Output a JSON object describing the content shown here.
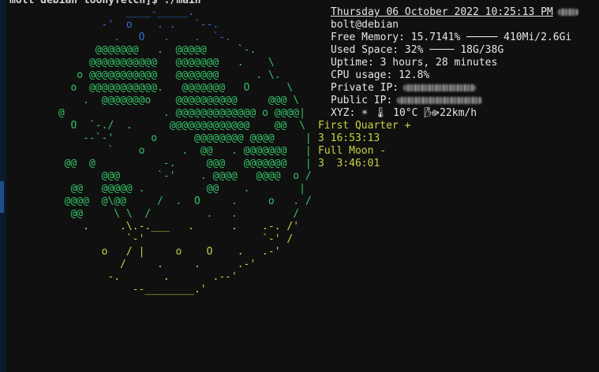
{
  "prompt": "mott debian toonyfetch]$ ./main",
  "art_lines": [
    {
      "color": "blue",
      "text": "            ____-_____."
    },
    {
      "color": "blue",
      "text": "        -'  o    . .   `--."
    },
    {
      "color": "blue",
      "text": "          .   O   .    .  `-."
    },
    {
      "color": "green",
      "text": "       @@@@@@@   .  @@@@@     `-."
    },
    {
      "color": "green",
      "text": "      @@@@@@@@@@@   @@@@@@@   .    \\"
    },
    {
      "color": "green",
      "text": "    o @@@@@@@@@@@   @@@@@@@      . \\."
    },
    {
      "color": "green",
      "text": "   o  @@@@@@@@@@@.   @@@@@@@   O      \\"
    },
    {
      "color": "green",
      "text": "     .  @@@@@@@o    @@@@@@@@@@     @@@ \\"
    },
    {
      "color": "green",
      "text": " @                . @@@@@@@@@@@@@ o @@@@|"
    },
    {
      "color": "green",
      "text": "   O  `-./  .      @@@@@@@@@@@@@    @@  \\"
    },
    {
      "color": "green",
      "text": "     --`-'      o      @@@@@@@@ @@@@     |"
    },
    {
      "color": "green",
      "text": "         `    o      .  @@   . @@@@@@@   |"
    },
    {
      "color": "green",
      "text": "  @@  @           -.     @@@   @@@@@@@   |"
    },
    {
      "color": "green",
      "text": "        @@@      `-'    . @@@@   @@@@  o /"
    },
    {
      "color": "green",
      "text": "   @@   @@@@@ .          @@    .        |"
    },
    {
      "color": "green",
      "text": "  @@@@  @\\@@     /  .  O     .     o   . /"
    },
    {
      "color": "green",
      "text": "   @@     \\ \\  /         .   .         /"
    },
    {
      "color": "yellow",
      "text": "     .     .\\.-.___   .      .    .-. /'"
    },
    {
      "color": "yellow",
      "text": "            `-'                   `-' /"
    },
    {
      "color": "yellow",
      "text": "        o   / |     o    O    .   .-'"
    },
    {
      "color": "yellow",
      "text": "           /     .     .      .-'"
    },
    {
      "color": "yellow",
      "text": "         -.       .       .--'"
    },
    {
      "color": "yellow",
      "text": "             --________.'"
    }
  ],
  "moon_phases": [
    "First Quarter +",
    "3 16:53:13",
    "Full Moon -",
    "3  3:46:01"
  ],
  "info": {
    "date": "Thursday 06 October 2022 10:25:13 PM",
    "user_host": "bolt@debian",
    "free_memory": "Free Memory: 15.7141% ───── 410Mi/2.6Gi",
    "used_space": "Used Space: 32% ──── 18G/38G",
    "uptime": "Uptime: 3 hours, 28 minutes",
    "cpu": "CPU usage: 12.8%",
    "private_ip_label": "Private IP:",
    "public_ip_label": "Public IP:",
    "weather_label": "XYZ:",
    "weather_sun": "☀",
    "weather_thermo": "🌡",
    "weather_temp": "10°C",
    "weather_wind": "↗22km/h"
  }
}
